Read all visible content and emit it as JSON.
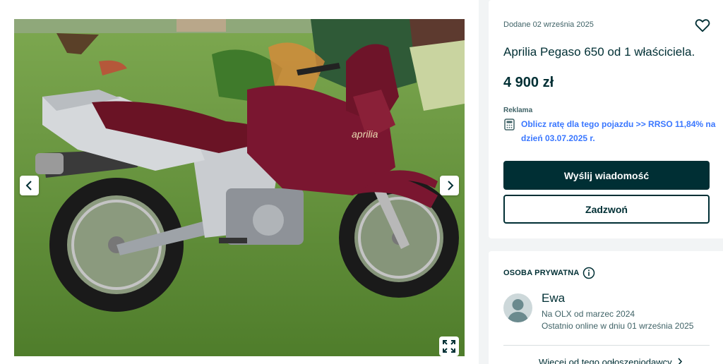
{
  "listing": {
    "date": "Dodane 02 września 2025",
    "title": "Aprilia Pegaso 650 od 1 właściciela.",
    "price": "4 900 zł",
    "ad_label": "Reklama",
    "financing_link": "Oblicz ratę dla tego pojazdu >> RRSO 11,84% na dzień 03.07.2025 r.",
    "message_button": "Wyślij wiadomość",
    "call_button": "Zadzwoń",
    "favorite_icon": "heart-icon",
    "calculator_icon": "calculator-icon"
  },
  "gallery": {
    "photo_brand_text": "aprilia",
    "prev_icon": "chevron-left-icon",
    "next_icon": "chevron-right-icon",
    "expand_icon": "expand-icon"
  },
  "seller": {
    "type_label": "OSOBA PRYWATNA",
    "info_icon": "info-icon",
    "name": "Ewa",
    "member_since": "Na OLX od marzec 2024",
    "last_online": "Ostatnio online w dniu 01 września 2025",
    "more_link": "Więcej od tego ogłoszeniodawcy",
    "more_icon": "chevron-right-icon"
  },
  "colors": {
    "primary": "#002f34",
    "link": "#3a77ff",
    "bike_body": "#7a1630"
  }
}
